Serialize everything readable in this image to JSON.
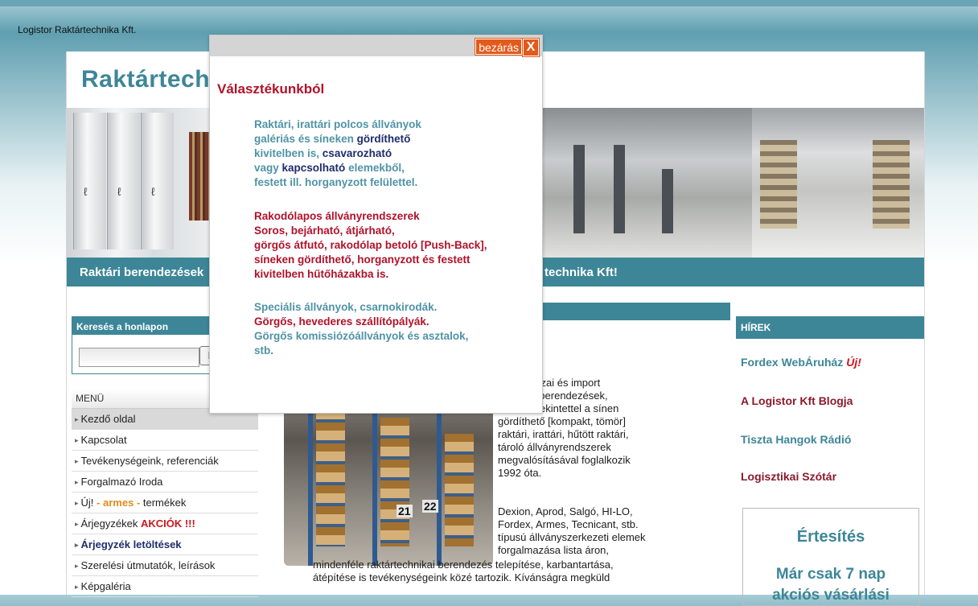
{
  "site": {
    "name": "Logistor Raktártechnika Kft."
  },
  "logo": {
    "text": "Raktártechnika"
  },
  "banner": {
    "left_text": "Raktári berendezések",
    "right_text": "technika Kft!"
  },
  "search": {
    "title": "Keresés a honlapon",
    "button": "K",
    "placeholder": ""
  },
  "menu": {
    "title": "MENÜ",
    "items": [
      {
        "label": "Kezdő oldal"
      },
      {
        "label": "Kapcsolat"
      },
      {
        "label": "Tevékenységeink, referenciák"
      },
      {
        "label": "Forgalmazó Iroda"
      },
      {
        "prefix": "Új!",
        "mid": "- armes -",
        "suffix": "termékek"
      },
      {
        "prefix": "Árjegyzékek",
        "highlight": "AKCIÓK !!!"
      },
      {
        "label": "Árjegyzék letöltések"
      },
      {
        "label": "Szerelési útmutatók, leírások"
      },
      {
        "label": "Képgaléria"
      }
    ]
  },
  "content": {
    "para1": "águnk hazai és import\nechnikai berendezések,\nkülönös tekintettel a sínen\ngördíthető [kompakt, tömör]\nraktári, irattári, hűtött raktári,\ntároló állványrendszerek\nmegvalósításával foglalkozik\n1992 óta.",
    "para2": "Dexion, Aprod, Salgó, HI-LO,\nFordex, Armes, Tecnicant, stb.\ntípusú állványszerkezeti elemek\nforgalmazása lista áron,",
    "para3": "mindenféle raktártechnikai berendezés telepítése, karbantartása,\nátépítése is tevékenységeink közé tartozik. Kívánságra megküld",
    "photo_numbers": [
      "21",
      "22"
    ]
  },
  "news": {
    "title": "HÍREK",
    "items": [
      {
        "label": "Fordex WebÁruház",
        "badge": "Új!",
        "color": "#3d8698"
      },
      {
        "label": "A Logistor Kft Blogja",
        "color": "#8b1a2c"
      },
      {
        "label": "Tiszta Hangok Rádió",
        "color": "#3d8698"
      },
      {
        "label": "Logisztikai Szótár",
        "color": "#8b1a2c"
      }
    ]
  },
  "notice": {
    "title": "Értesítés",
    "line1": "Már csak 7 nap",
    "line2": "akciós vásárlási"
  },
  "popup": {
    "close_label": "bezárás",
    "close_icon": "X",
    "title": "Választékunkból",
    "block1": {
      "l1": "Raktári, irattári polcos állványok",
      "l2a": "galériás és síneken ",
      "l2b": "gördíthető",
      "l3a": "kivitelben is, ",
      "l3b": "csavarozható",
      "l4a": "vagy ",
      "l4b": "kapcsolható",
      "l4c": " elemekből,",
      "l5": "festett ill. horganyzott felülettel."
    },
    "block2": {
      "l1": "Rakodólapos állványrendszerek",
      "l2": "Soros, bejárható, átjárható,",
      "l3": "görgős átfutó, rakodólap betoló [Push-Back],",
      "l4": "síneken gördíthető, horganyzott és festett",
      "l5": "kivitelben hűtőházakba is."
    },
    "block3": {
      "l1": "Speciális állványok, csarnokirodák.",
      "l2": "Görgős, hevederes szállítópályák.",
      "l3": "Görgős komissiózóállványok és asztalok,",
      "l4": "stb."
    }
  },
  "colors": {
    "accent": "#3d8698",
    "popup_title": "#b0122a",
    "close_button": "#e25a1c"
  }
}
